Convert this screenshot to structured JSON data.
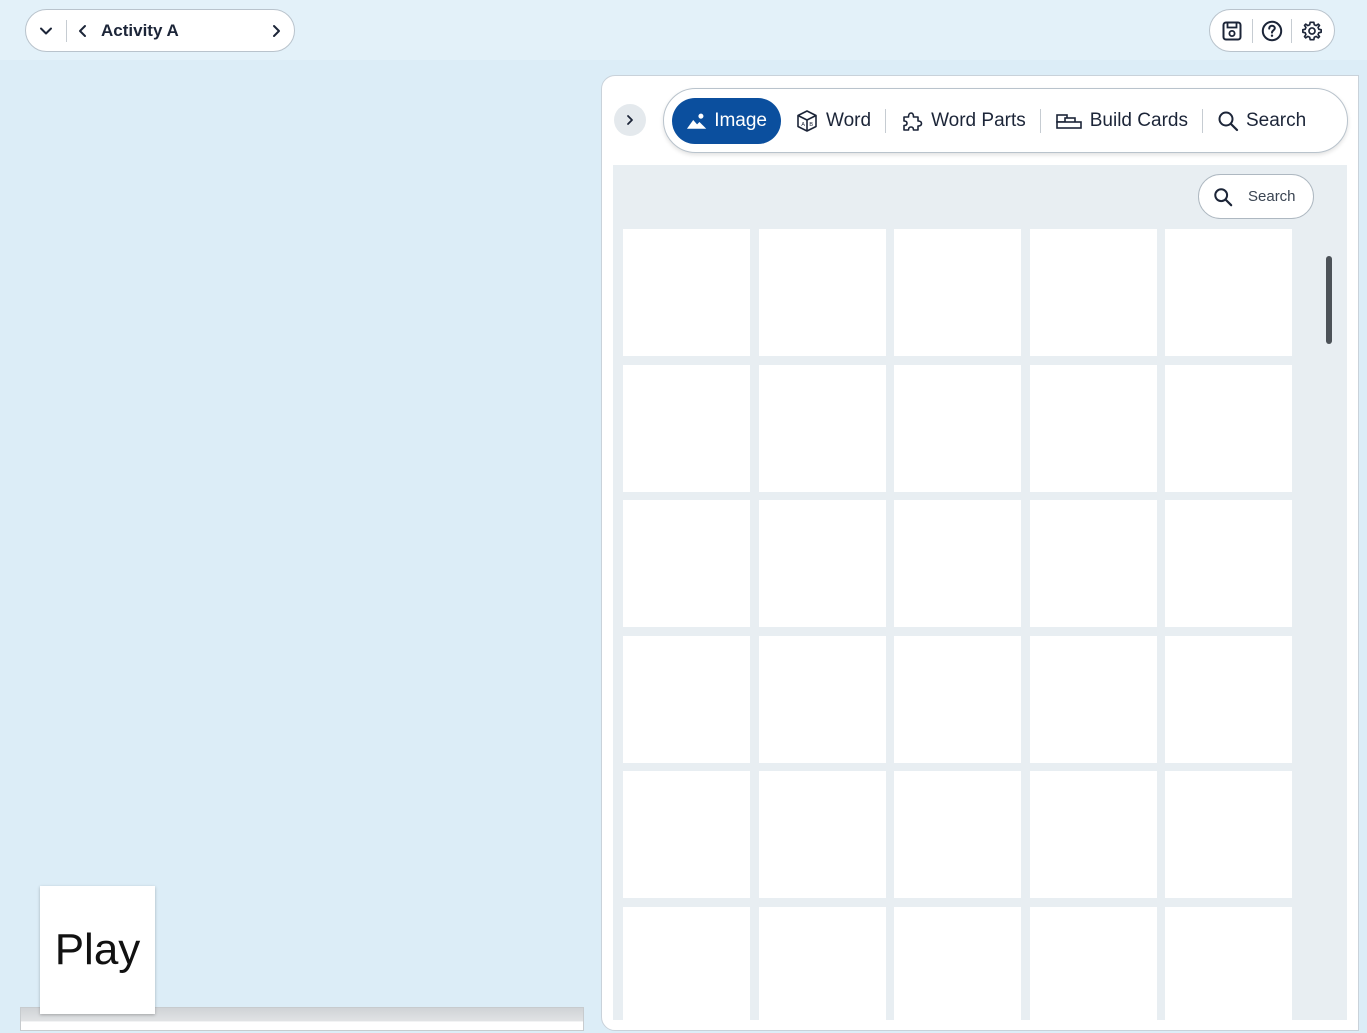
{
  "topbar": {
    "activity_title": "Activity A"
  },
  "panel": {
    "tabs": [
      {
        "label": "Image",
        "icon": "image-icon",
        "active": true
      },
      {
        "label": "Word",
        "icon": "cube-icon",
        "active": false
      },
      {
        "label": "Word Parts",
        "icon": "puzzle-icon",
        "active": false
      },
      {
        "label": "Build Cards",
        "icon": "cards-icon",
        "active": false
      },
      {
        "label": "Search",
        "icon": "search-icon",
        "active": false
      }
    ],
    "search_placeholder": "Search"
  },
  "play_card": {
    "label": "Play"
  },
  "colors": {
    "background": "#dcedf7",
    "active_tab": "#0b4f9e",
    "gallery_bg": "#e8eef2"
  }
}
